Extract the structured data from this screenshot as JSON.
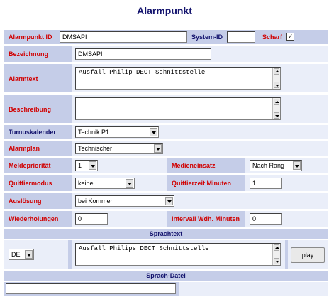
{
  "title": "Alarmpunkt",
  "fields": {
    "alarmpunkt_id_label": "Alarmpunkt ID",
    "alarmpunkt_id_value": "DMSAPI",
    "system_id_label": "System-ID",
    "system_id_value": "",
    "scharf_label": "Scharf",
    "scharf_checked": "✓",
    "bezeichnung_label": "Bezeichnung",
    "bezeichnung_value": "DMSAPI",
    "alarmtext_label": "Alarmtext",
    "alarmtext_value": "Ausfall Philip DECT Schnittstelle",
    "beschreibung_label": "Beschreibung",
    "beschreibung_value": "",
    "turnuskalender_label": "Turnuskalender",
    "turnuskalender_value": "Technik P1",
    "alarmplan_label": "Alarmplan",
    "alarmplan_value": "Technischer",
    "meldeprioritaet_label": "Meldepriorität",
    "meldeprioritaet_value": "1",
    "medieneinsatz_label": "Medieneinsatz",
    "medieneinsatz_value": "Nach Rang",
    "quittiermodus_label": "Quittiermodus",
    "quittiermodus_value": "keine",
    "quittierzeit_label": "Quittierzeit Minuten",
    "quittierzeit_value": "1",
    "ausloesung_label": "Auslösung",
    "ausloesung_value": "bei Kommen",
    "wiederholungen_label": "Wiederholungen",
    "wiederholungen_value": "0",
    "intervall_label": "Intervall Wdh. Minuten",
    "intervall_value": "0"
  },
  "sprachtext": {
    "header": "Sprachtext",
    "language": "DE",
    "text": "Ausfall Philips DECT Schnittstelle",
    "play_label": "play"
  },
  "sprachdatei": {
    "header": "Sprach-Datei",
    "value": ""
  }
}
